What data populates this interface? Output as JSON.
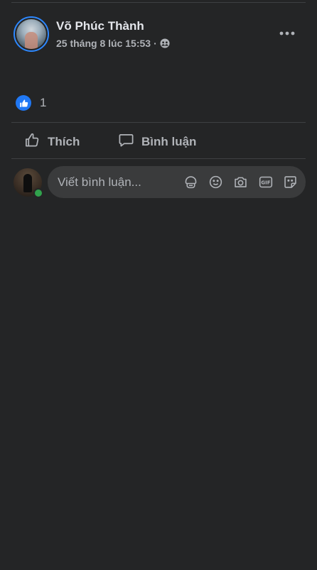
{
  "post": {
    "author_name": "Võ Phúc Thành",
    "timestamp": "25 tháng 8 lúc 15:53",
    "separator": "·",
    "audience_icon": "friends-audience-icon",
    "more_icon": "more-options-icon"
  },
  "reactions": {
    "icon": "like-reaction-icon",
    "count": "1"
  },
  "actions": {
    "like_label": "Thích",
    "comment_label": "Bình luận"
  },
  "composer": {
    "placeholder": "Viết bình luận...",
    "icons": [
      "avatar-sticker-icon",
      "emoji-icon",
      "camera-icon",
      "gif-icon",
      "sticker-icon"
    ],
    "online_status_color": "#31a24c"
  },
  "colors": {
    "background": "#242526",
    "accent": "#2078f4",
    "text_secondary": "#b0b3b8"
  }
}
